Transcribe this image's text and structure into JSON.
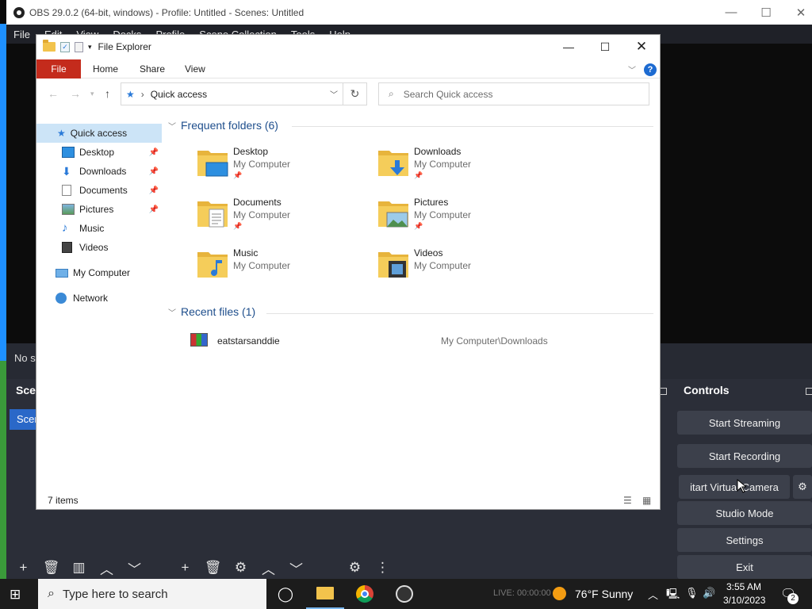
{
  "obs": {
    "window_title": "OBS 29.0.2 (64-bit, windows) - Profile: Untitled - Scenes: Untitled",
    "menu": [
      "File",
      "Edit",
      "View",
      "Docks",
      "Profile",
      "Scene Collection",
      "Tools",
      "Help"
    ],
    "no_source_text": "No s",
    "scenes_title": "Scen",
    "scene_item": "Scen",
    "controls_title": "Controls",
    "controls": {
      "start_streaming": "Start Streaming",
      "start_recording": "Start Recording",
      "start_virtual_camera": "itart Virtual Camera",
      "studio_mode": "Studio Mode",
      "settings": "Settings",
      "exit": "Exit"
    }
  },
  "explorer": {
    "title": "File Explorer",
    "ribbon_tabs": [
      "File",
      "Home",
      "Share",
      "View"
    ],
    "address": "Quick access",
    "search_placeholder": "Search Quick access",
    "nav": {
      "quick_access": "Quick access",
      "desktop": "Desktop",
      "downloads": "Downloads",
      "documents": "Documents",
      "pictures": "Pictures",
      "music": "Music",
      "videos": "Videos",
      "my_computer": "My Computer",
      "network": "Network"
    },
    "frequent_header": "Frequent folders (6)",
    "frequent": [
      {
        "name": "Desktop",
        "location": "My Computer",
        "pinned": true
      },
      {
        "name": "Downloads",
        "location": "My Computer",
        "pinned": true
      },
      {
        "name": "Documents",
        "location": "My Computer",
        "pinned": true
      },
      {
        "name": "Pictures",
        "location": "My Computer",
        "pinned": true
      },
      {
        "name": "Music",
        "location": "My Computer",
        "pinned": false
      },
      {
        "name": "Videos",
        "location": "My Computer",
        "pinned": false
      }
    ],
    "recent_header": "Recent files (1)",
    "recent": [
      {
        "name": "eatstarsanddie",
        "path": "My Computer\\Downloads"
      }
    ],
    "status": "7 items"
  },
  "taskbar": {
    "search_placeholder": "Type here to search",
    "weather": "76°F  Sunny",
    "live": "LIVE: 00:00:00",
    "time": "3:55 AM",
    "date": "3/10/2023",
    "notifications": "2"
  },
  "colors": {
    "obs_bg": "#272a33",
    "accent_blue": "#2a68c8",
    "explorer_file_tab": "#c42b1c",
    "selection": "#cce4f7",
    "folder_yellow": "#f2c34c"
  }
}
